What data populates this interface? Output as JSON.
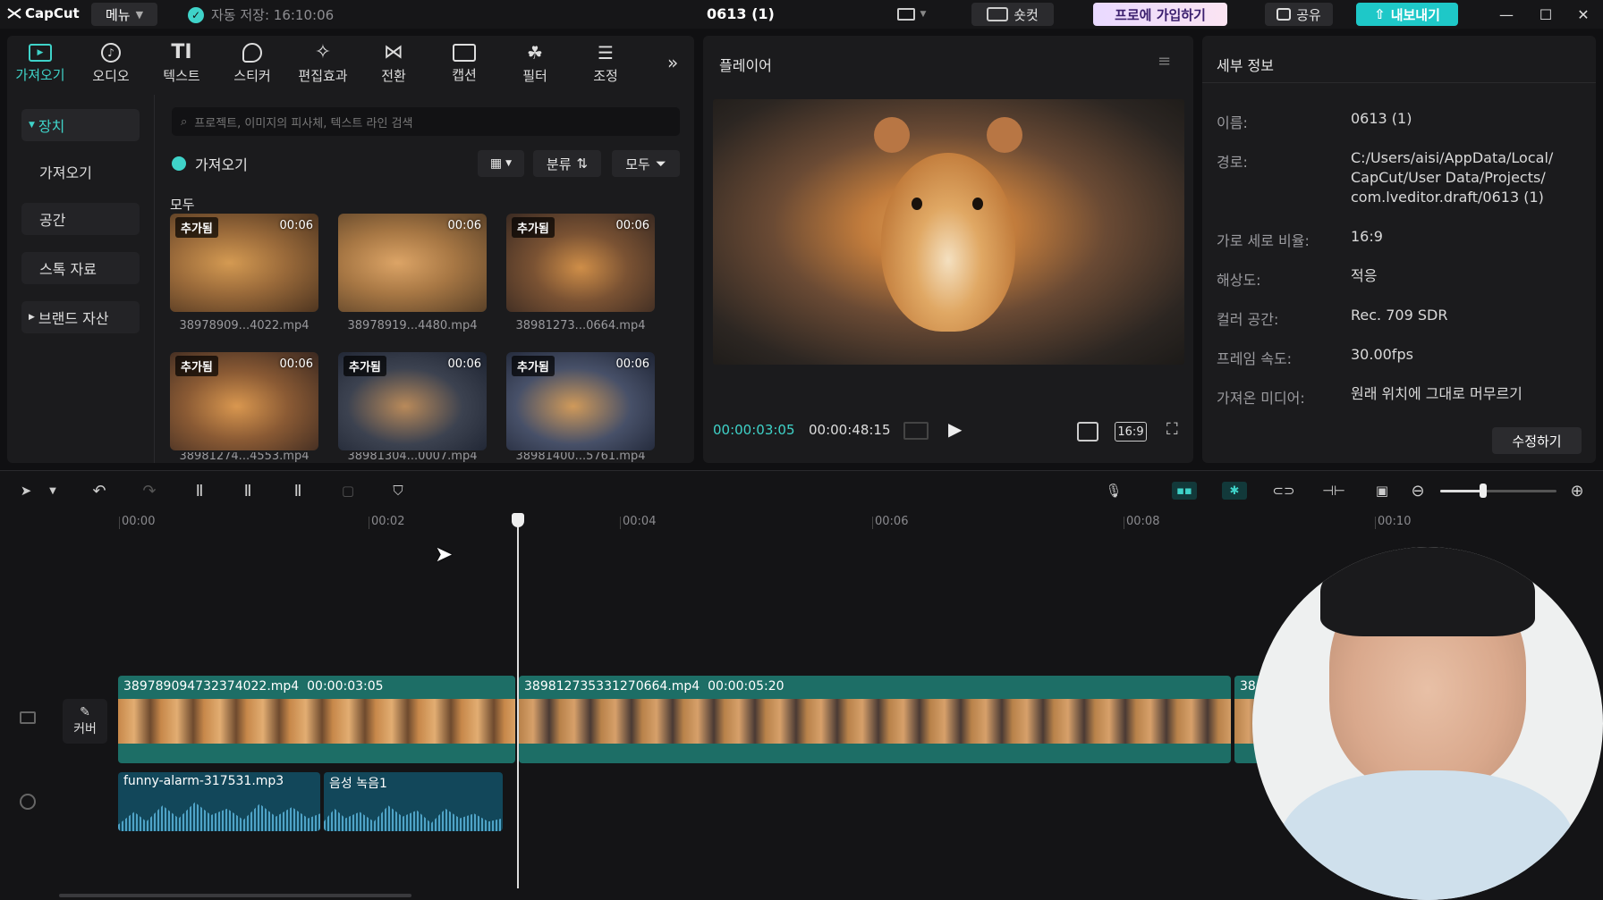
{
  "app": {
    "logo": "CapCut",
    "menu_label": "메뉴",
    "autosave": "자동 저장: 16:10:06",
    "project_title": "0613 (1)"
  },
  "topbar": {
    "shortcut": "숏컷",
    "pro": "프로에 가입하기",
    "share": "공유",
    "export": "내보내기"
  },
  "toolbar": [
    {
      "label": "가져오기",
      "icon": "import-icon"
    },
    {
      "label": "오디오",
      "icon": "audio-icon"
    },
    {
      "label": "텍스트",
      "icon": "text-icon"
    },
    {
      "label": "스티커",
      "icon": "sticker-icon"
    },
    {
      "label": "편집효과",
      "icon": "effects-icon"
    },
    {
      "label": "전환",
      "icon": "transition-icon"
    },
    {
      "label": "캡션",
      "icon": "caption-icon"
    },
    {
      "label": "필터",
      "icon": "filter-icon"
    },
    {
      "label": "조정",
      "icon": "adjust-icon"
    }
  ],
  "sidebar": {
    "items": [
      "장치",
      "가져오기",
      "공간",
      "스톡 자료",
      "브랜드 자산"
    ]
  },
  "media": {
    "search_placeholder": "프로젝트, 이미지의 피사체, 텍스트 라인 검색",
    "import_label": "가져오기",
    "sort_label": "분류",
    "filter_label": "모두",
    "section_label": "모두",
    "thumbs": [
      {
        "added": "추가됨",
        "duration": "00:06",
        "name": "38978909...4022.mp4"
      },
      {
        "added": "",
        "duration": "00:06",
        "name": "38978919...4480.mp4"
      },
      {
        "added": "추가됨",
        "duration": "00:06",
        "name": "38981273...0664.mp4"
      },
      {
        "added": "추가됨",
        "duration": "00:06",
        "name": "38981274...4553.mp4"
      },
      {
        "added": "추가됨",
        "duration": "00:06",
        "name": "38981304...0007.mp4"
      },
      {
        "added": "추가됨",
        "duration": "00:06",
        "name": "38981400...5761.mp4"
      }
    ]
  },
  "player": {
    "title": "플레이어",
    "current_time": "00:00:03:05",
    "total_time": "00:00:48:15",
    "ratio": "16:9"
  },
  "details": {
    "title": "세부 정보",
    "rows": [
      {
        "key": "이름:",
        "value": "0613 (1)"
      },
      {
        "key": "경로:",
        "value": "C:/Users/aisi/AppData/Local/ CapCut/User Data/Projects/ com.lveditor.draft/0613 (1)"
      },
      {
        "key": "가로 세로 비율:",
        "value": "16:9"
      },
      {
        "key": "해상도:",
        "value": "적응"
      },
      {
        "key": "컬러 공간:",
        "value": "Rec. 709 SDR"
      },
      {
        "key": "프레임 속도:",
        "value": "30.00fps"
      },
      {
        "key": "가져온 미디어:",
        "value": "원래 위치에 그대로 머무르기"
      }
    ],
    "edit_button": "수정하기"
  },
  "timeline": {
    "ticks": [
      "00:00",
      "00:02",
      "00:04",
      "00:06",
      "00:08",
      "00:10"
    ],
    "cover_label": "커버",
    "clips": [
      {
        "name": "389789094732374022.mp4",
        "duration": "00:00:03:05"
      },
      {
        "name": "389812735331270664.mp4",
        "duration": "00:00:05:20"
      },
      {
        "name": "38",
        "duration": ""
      }
    ],
    "audio": [
      {
        "name": "funny-alarm-317531.mp3"
      },
      {
        "name": "음성 녹음1"
      }
    ]
  },
  "colors": {
    "accent": "#3fd3c9",
    "clip": "#1d6e66",
    "audio": "#12475a"
  }
}
